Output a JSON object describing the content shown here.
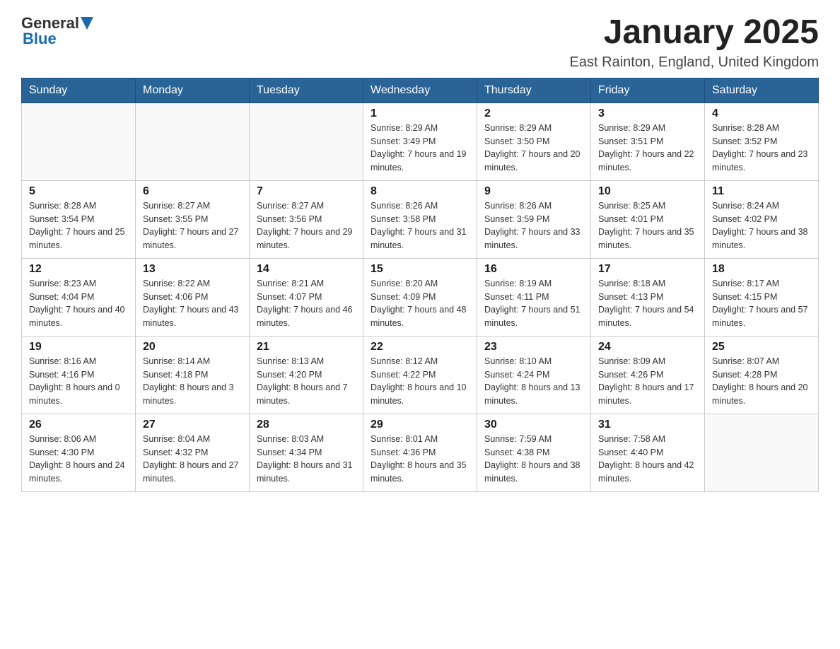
{
  "header": {
    "logo_general": "General",
    "logo_blue": "Blue",
    "title": "January 2025",
    "subtitle": "East Rainton, England, United Kingdom"
  },
  "days_of_week": [
    "Sunday",
    "Monday",
    "Tuesday",
    "Wednesday",
    "Thursday",
    "Friday",
    "Saturday"
  ],
  "weeks": [
    [
      {
        "day": "",
        "sunrise": "",
        "sunset": "",
        "daylight": ""
      },
      {
        "day": "",
        "sunrise": "",
        "sunset": "",
        "daylight": ""
      },
      {
        "day": "",
        "sunrise": "",
        "sunset": "",
        "daylight": ""
      },
      {
        "day": "1",
        "sunrise": "Sunrise: 8:29 AM",
        "sunset": "Sunset: 3:49 PM",
        "daylight": "Daylight: 7 hours and 19 minutes."
      },
      {
        "day": "2",
        "sunrise": "Sunrise: 8:29 AM",
        "sunset": "Sunset: 3:50 PM",
        "daylight": "Daylight: 7 hours and 20 minutes."
      },
      {
        "day": "3",
        "sunrise": "Sunrise: 8:29 AM",
        "sunset": "Sunset: 3:51 PM",
        "daylight": "Daylight: 7 hours and 22 minutes."
      },
      {
        "day": "4",
        "sunrise": "Sunrise: 8:28 AM",
        "sunset": "Sunset: 3:52 PM",
        "daylight": "Daylight: 7 hours and 23 minutes."
      }
    ],
    [
      {
        "day": "5",
        "sunrise": "Sunrise: 8:28 AM",
        "sunset": "Sunset: 3:54 PM",
        "daylight": "Daylight: 7 hours and 25 minutes."
      },
      {
        "day": "6",
        "sunrise": "Sunrise: 8:27 AM",
        "sunset": "Sunset: 3:55 PM",
        "daylight": "Daylight: 7 hours and 27 minutes."
      },
      {
        "day": "7",
        "sunrise": "Sunrise: 8:27 AM",
        "sunset": "Sunset: 3:56 PM",
        "daylight": "Daylight: 7 hours and 29 minutes."
      },
      {
        "day": "8",
        "sunrise": "Sunrise: 8:26 AM",
        "sunset": "Sunset: 3:58 PM",
        "daylight": "Daylight: 7 hours and 31 minutes."
      },
      {
        "day": "9",
        "sunrise": "Sunrise: 8:26 AM",
        "sunset": "Sunset: 3:59 PM",
        "daylight": "Daylight: 7 hours and 33 minutes."
      },
      {
        "day": "10",
        "sunrise": "Sunrise: 8:25 AM",
        "sunset": "Sunset: 4:01 PM",
        "daylight": "Daylight: 7 hours and 35 minutes."
      },
      {
        "day": "11",
        "sunrise": "Sunrise: 8:24 AM",
        "sunset": "Sunset: 4:02 PM",
        "daylight": "Daylight: 7 hours and 38 minutes."
      }
    ],
    [
      {
        "day": "12",
        "sunrise": "Sunrise: 8:23 AM",
        "sunset": "Sunset: 4:04 PM",
        "daylight": "Daylight: 7 hours and 40 minutes."
      },
      {
        "day": "13",
        "sunrise": "Sunrise: 8:22 AM",
        "sunset": "Sunset: 4:06 PM",
        "daylight": "Daylight: 7 hours and 43 minutes."
      },
      {
        "day": "14",
        "sunrise": "Sunrise: 8:21 AM",
        "sunset": "Sunset: 4:07 PM",
        "daylight": "Daylight: 7 hours and 46 minutes."
      },
      {
        "day": "15",
        "sunrise": "Sunrise: 8:20 AM",
        "sunset": "Sunset: 4:09 PM",
        "daylight": "Daylight: 7 hours and 48 minutes."
      },
      {
        "day": "16",
        "sunrise": "Sunrise: 8:19 AM",
        "sunset": "Sunset: 4:11 PM",
        "daylight": "Daylight: 7 hours and 51 minutes."
      },
      {
        "day": "17",
        "sunrise": "Sunrise: 8:18 AM",
        "sunset": "Sunset: 4:13 PM",
        "daylight": "Daylight: 7 hours and 54 minutes."
      },
      {
        "day": "18",
        "sunrise": "Sunrise: 8:17 AM",
        "sunset": "Sunset: 4:15 PM",
        "daylight": "Daylight: 7 hours and 57 minutes."
      }
    ],
    [
      {
        "day": "19",
        "sunrise": "Sunrise: 8:16 AM",
        "sunset": "Sunset: 4:16 PM",
        "daylight": "Daylight: 8 hours and 0 minutes."
      },
      {
        "day": "20",
        "sunrise": "Sunrise: 8:14 AM",
        "sunset": "Sunset: 4:18 PM",
        "daylight": "Daylight: 8 hours and 3 minutes."
      },
      {
        "day": "21",
        "sunrise": "Sunrise: 8:13 AM",
        "sunset": "Sunset: 4:20 PM",
        "daylight": "Daylight: 8 hours and 7 minutes."
      },
      {
        "day": "22",
        "sunrise": "Sunrise: 8:12 AM",
        "sunset": "Sunset: 4:22 PM",
        "daylight": "Daylight: 8 hours and 10 minutes."
      },
      {
        "day": "23",
        "sunrise": "Sunrise: 8:10 AM",
        "sunset": "Sunset: 4:24 PM",
        "daylight": "Daylight: 8 hours and 13 minutes."
      },
      {
        "day": "24",
        "sunrise": "Sunrise: 8:09 AM",
        "sunset": "Sunset: 4:26 PM",
        "daylight": "Daylight: 8 hours and 17 minutes."
      },
      {
        "day": "25",
        "sunrise": "Sunrise: 8:07 AM",
        "sunset": "Sunset: 4:28 PM",
        "daylight": "Daylight: 8 hours and 20 minutes."
      }
    ],
    [
      {
        "day": "26",
        "sunrise": "Sunrise: 8:06 AM",
        "sunset": "Sunset: 4:30 PM",
        "daylight": "Daylight: 8 hours and 24 minutes."
      },
      {
        "day": "27",
        "sunrise": "Sunrise: 8:04 AM",
        "sunset": "Sunset: 4:32 PM",
        "daylight": "Daylight: 8 hours and 27 minutes."
      },
      {
        "day": "28",
        "sunrise": "Sunrise: 8:03 AM",
        "sunset": "Sunset: 4:34 PM",
        "daylight": "Daylight: 8 hours and 31 minutes."
      },
      {
        "day": "29",
        "sunrise": "Sunrise: 8:01 AM",
        "sunset": "Sunset: 4:36 PM",
        "daylight": "Daylight: 8 hours and 35 minutes."
      },
      {
        "day": "30",
        "sunrise": "Sunrise: 7:59 AM",
        "sunset": "Sunset: 4:38 PM",
        "daylight": "Daylight: 8 hours and 38 minutes."
      },
      {
        "day": "31",
        "sunrise": "Sunrise: 7:58 AM",
        "sunset": "Sunset: 4:40 PM",
        "daylight": "Daylight: 8 hours and 42 minutes."
      },
      {
        "day": "",
        "sunrise": "",
        "sunset": "",
        "daylight": ""
      }
    ]
  ]
}
